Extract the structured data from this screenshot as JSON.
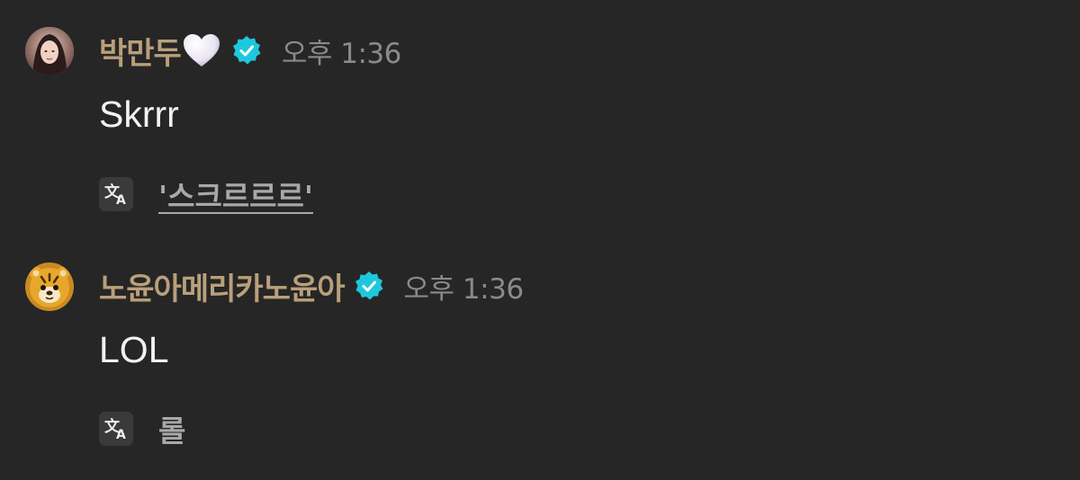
{
  "messages": [
    {
      "avatar_icon": "user-avatar-photo",
      "username": "박만두",
      "username_emoji": "white-heart-icon",
      "verified_icon": "verified-badge-icon",
      "time": "오후 1:36",
      "text": "Skrrr",
      "translate_icon": "translate-icon",
      "translation": "'스크르르르'"
    },
    {
      "avatar_icon": "user-avatar-tiger-doll",
      "username": "노윤아메리카노윤아",
      "verified_icon": "verified-badge-icon",
      "time": "오후 1:36",
      "text": "LOL",
      "translate_icon": "translate-icon",
      "translation": "롤"
    }
  ],
  "colors": {
    "background": "#262626",
    "username": "#b9a07b",
    "time": "#8a8a8a",
    "message_text": "#f2f2f2",
    "translation_text": "#a8a8a8",
    "verified_badge": "#1ec8dc"
  }
}
